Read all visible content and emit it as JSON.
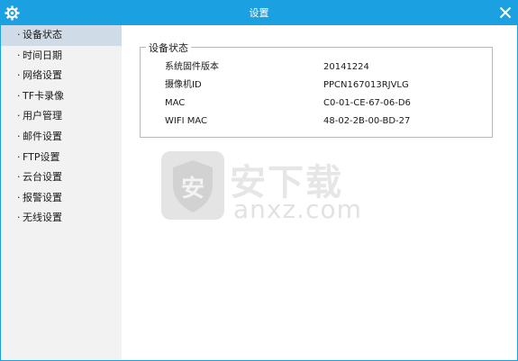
{
  "titlebar": {
    "title": "设置",
    "logo_icon": "gear-icon",
    "close_icon": "close-icon",
    "color": "#1ba1e2"
  },
  "sidebar": {
    "bullet": "·",
    "active_index": 0,
    "items": [
      {
        "label": "设备状态"
      },
      {
        "label": "时间日期"
      },
      {
        "label": "网络设置"
      },
      {
        "label": "TF卡录像"
      },
      {
        "label": "用户管理"
      },
      {
        "label": "邮件设置"
      },
      {
        "label": "FTP设置"
      },
      {
        "label": "云台设置"
      },
      {
        "label": "报警设置"
      },
      {
        "label": "无线设置"
      }
    ]
  },
  "device_status": {
    "legend": "设备状态",
    "rows": [
      {
        "label": "系统固件版本",
        "value": "20141224"
      },
      {
        "label": "摄像机ID",
        "value": "PPCN167013RJVLG"
      },
      {
        "label": "MAC",
        "value": "C0-01-CE-67-06-D6"
      },
      {
        "label": "WIFI MAC",
        "value": "48-02-2B-00-BD-27"
      }
    ]
  },
  "watermark": {
    "cn_text": "安下载",
    "en_text": "anxz.com",
    "shield_text": "安"
  }
}
